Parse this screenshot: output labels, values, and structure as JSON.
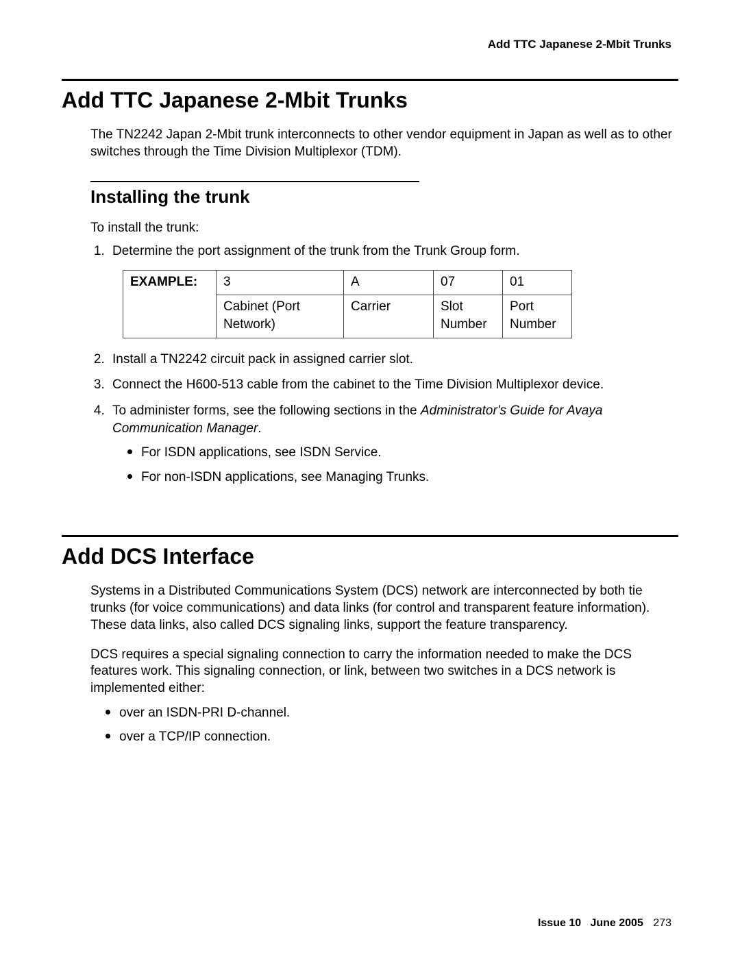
{
  "running_head": "Add TTC Japanese 2-Mbit Trunks",
  "section1": {
    "title": "Add TTC Japanese 2-Mbit Trunks",
    "intro": "The TN2242 Japan 2-Mbit trunk interconnects to other vendor equipment in Japan as well as to other switches through the Time Division Multiplexor (TDM).",
    "sub_title": "Installing the trunk",
    "lead_in": "To install the trunk:",
    "steps": {
      "s1": "Determine the port assignment of the trunk from the Trunk Group form.",
      "s2": "Install a TN2242 circuit pack in assigned carrier slot.",
      "s3": "Connect the H600-513 cable from the cabinet to the Time Division Multiplexor device.",
      "s4_pre": "To administer forms, see the following sections in the ",
      "s4_em": "Administrator's Guide for Avaya Communication Manager",
      "s4_post": ".",
      "s4_b1": "For ISDN applications, see ISDN Service.",
      "s4_b2": "For non-ISDN applications, see Managing Trunks."
    },
    "table": {
      "label": "EXAMPLE:",
      "r1": {
        "c1": "3",
        "c2": "A",
        "c3": "07",
        "c4": "01"
      },
      "r2": {
        "c1": "Cabinet (Port Network)",
        "c2": "Carrier",
        "c3": "Slot Number",
        "c4": "Port Number"
      }
    }
  },
  "section2": {
    "title": "Add DCS Interface",
    "p1": "Systems in a Distributed Communications System (DCS) network are interconnected by both tie trunks (for voice communications) and data links (for control and transparent feature information). These data links, also called DCS signaling links, support the feature transparency.",
    "p2": "DCS requires a special signaling connection to carry the information needed to make the DCS features work. This signaling connection, or link, between two switches in a DCS network is implemented either:",
    "b1": "over an ISDN-PRI D-channel.",
    "b2": "over a TCP/IP connection."
  },
  "footer": {
    "issue": "Issue 10",
    "date": "June 2005",
    "page": "273"
  }
}
